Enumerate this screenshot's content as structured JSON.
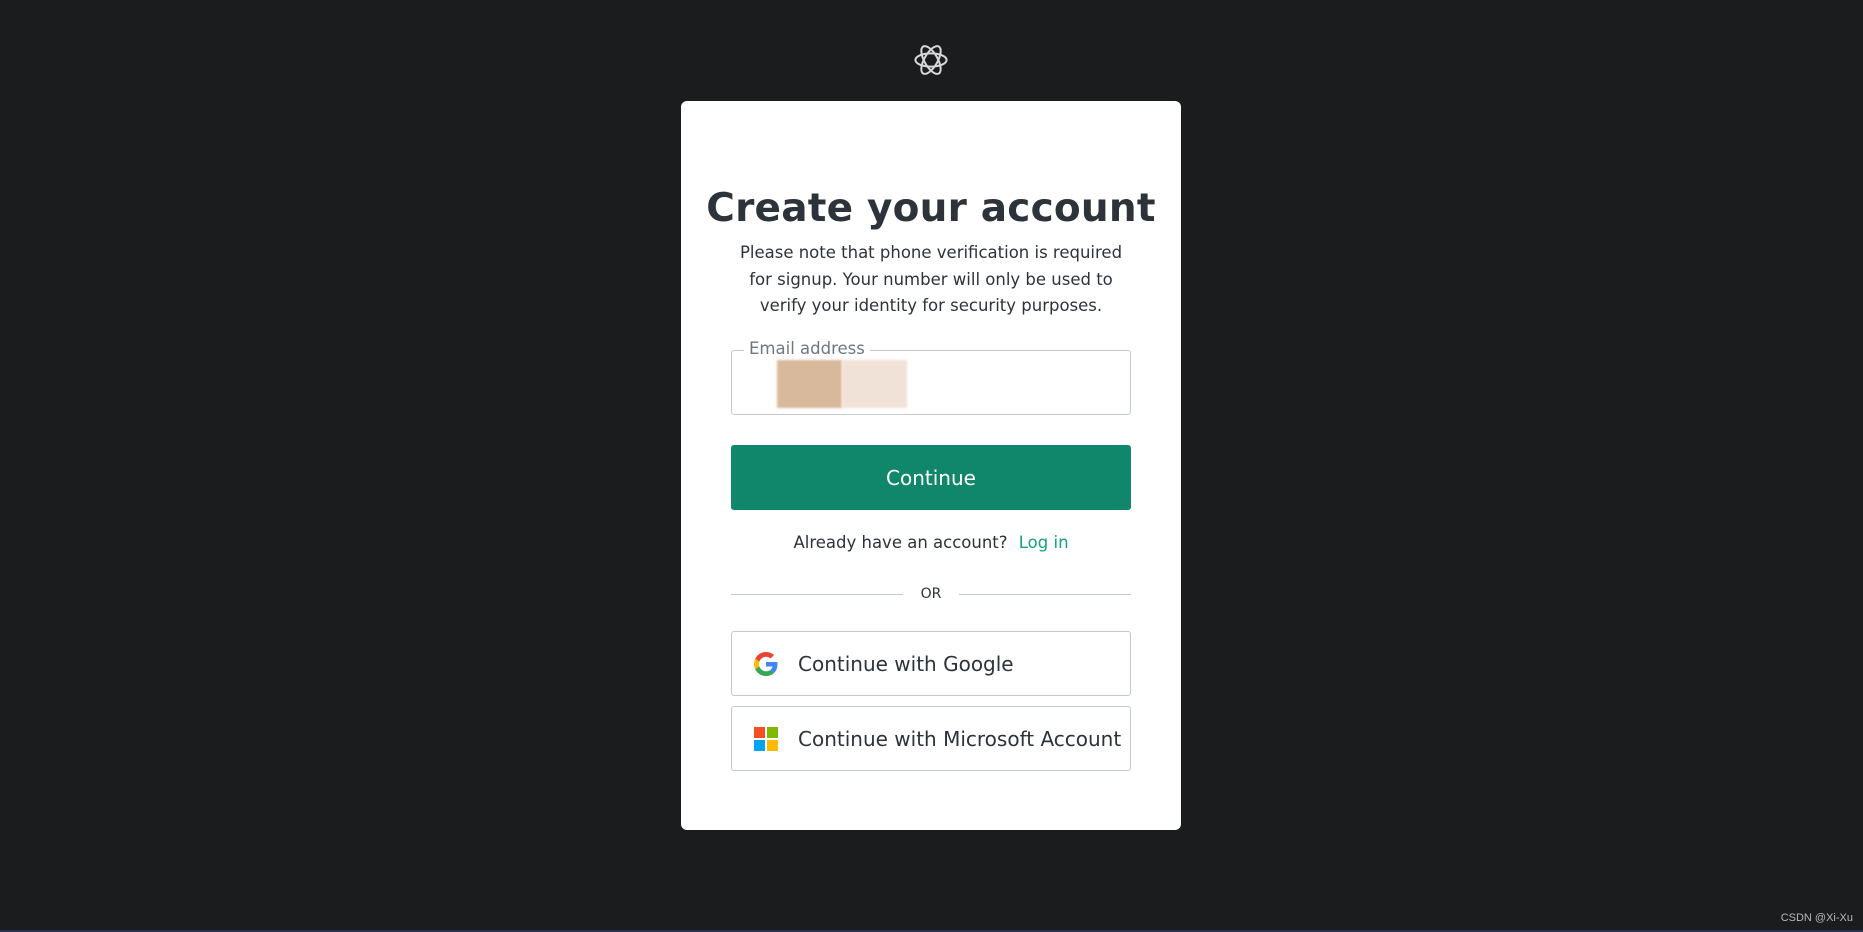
{
  "logo": {
    "icon": "openai-logo-icon"
  },
  "signup": {
    "title": "Create your account",
    "subtitle": "Please note that phone verification is required for signup. Your number will only be used to verify your identity for security purposes.",
    "email_label": "Email address",
    "continue_label": "Continue",
    "login_prompt": "Already have an account?",
    "login_link": "Log in",
    "divider_text": "OR",
    "google_label": "Continue with Google",
    "microsoft_label": "Continue with Microsoft Account"
  },
  "colors": {
    "background": "#1b1c1e",
    "card": "#ffffff",
    "accent": "#10a37f",
    "button": "#10866a",
    "text": "#2d333a",
    "border": "#c2c8d0"
  },
  "watermark": "CSDN @Xi-Xu"
}
